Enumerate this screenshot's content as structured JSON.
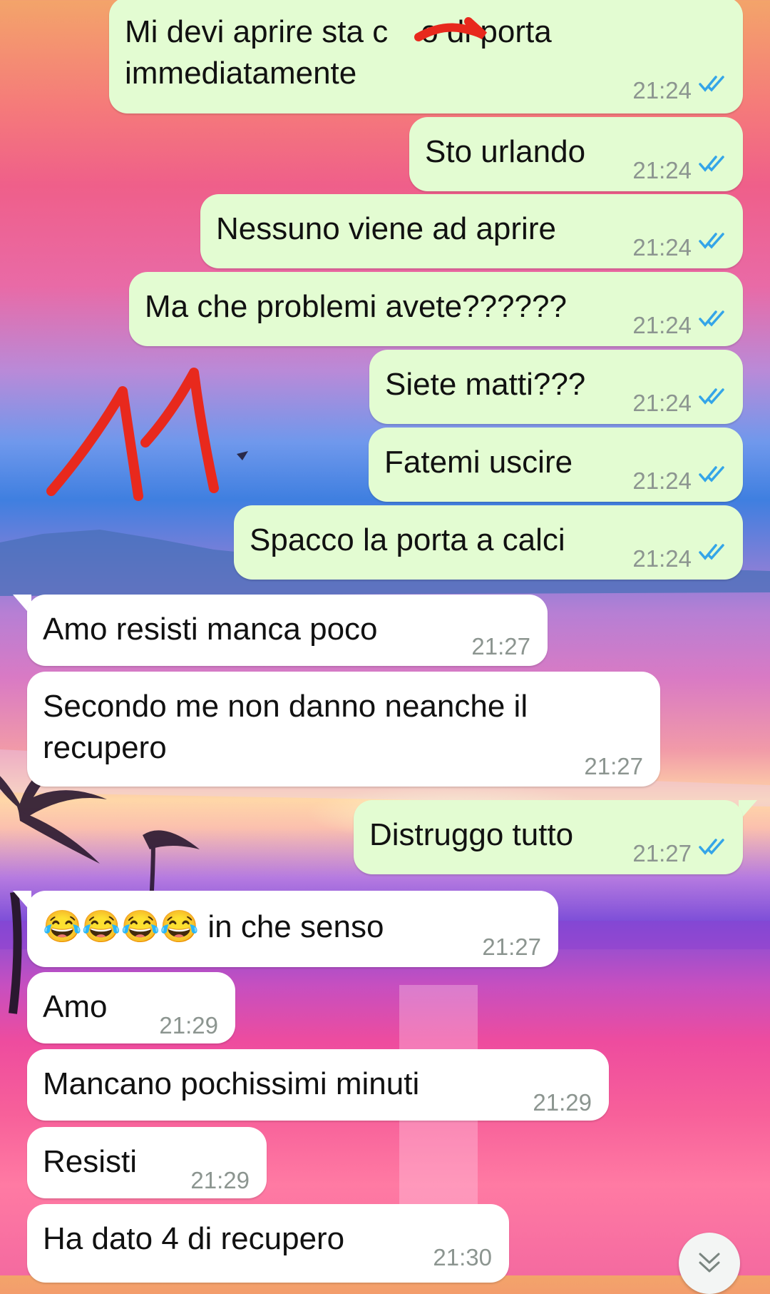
{
  "colors": {
    "outgoing_bubble": "#e3fcd2",
    "incoming_bubble": "#ffffff",
    "read_ticks": "#34a5e8",
    "annotation": "#e8291d"
  },
  "messages": [
    {
      "text_line1": "Mi devi aprire sta c",
      "text_line1_end": "o di porta",
      "text_line2": "immediatamente",
      "time": "21:24",
      "direction": "out",
      "status": "read"
    },
    {
      "text": "Sto urlando",
      "time": "21:24",
      "direction": "out",
      "status": "read"
    },
    {
      "text": "Nessuno viene ad aprire",
      "time": "21:24",
      "direction": "out",
      "status": "read"
    },
    {
      "text": "Ma che problemi avete??????",
      "time": "21:24",
      "direction": "out",
      "status": "read"
    },
    {
      "text": "Siete matti???",
      "time": "21:24",
      "direction": "out",
      "status": "read"
    },
    {
      "text": "Fatemi uscire",
      "time": "21:24",
      "direction": "out",
      "status": "read"
    },
    {
      "text": "Spacco la porta a calci",
      "time": "21:24",
      "direction": "out",
      "status": "read"
    },
    {
      "text": "Amo resisti manca poco",
      "time": "21:27",
      "direction": "in"
    },
    {
      "text_line1": "Secondo me non danno neanche il",
      "text_line2": "recupero",
      "time": "21:27",
      "direction": "in"
    },
    {
      "text": "Distruggo tutto",
      "time": "21:27",
      "direction": "out",
      "status": "read"
    },
    {
      "text": "😂😂😂😂 in che senso",
      "time": "21:27",
      "direction": "in"
    },
    {
      "text": "Amo",
      "time": "21:29",
      "direction": "in"
    },
    {
      "text": "Mancano pochissimi minuti",
      "time": "21:29",
      "direction": "in"
    },
    {
      "text": "Resisti",
      "time": "21:29",
      "direction": "in"
    },
    {
      "text": "Ha dato 4 di recupero",
      "time": "21:30",
      "direction": "in"
    }
  ],
  "annotation": {
    "icon": "hand-drawn-11"
  },
  "scroll_button": {
    "icon": "double-chevron-down-icon"
  }
}
